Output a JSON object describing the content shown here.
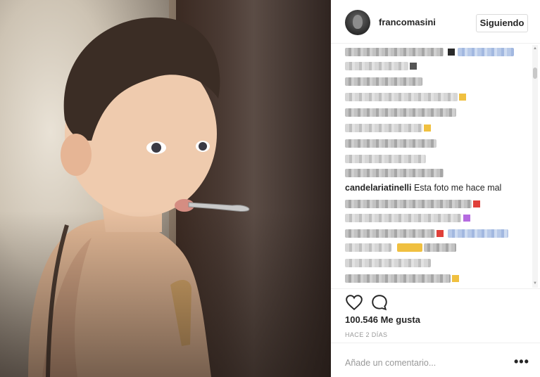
{
  "post": {
    "username": "francomasini",
    "follow_label": "Siguiendo",
    "likes": "100.546 Me gusta",
    "time_ago": "HACE 2 DÍAS",
    "add_comment_placeholder": "Añade un comentario...",
    "more_label": "•••"
  },
  "comments": {
    "visible_user": "candelariatinelli",
    "visible_text": "Esta foto me hace mal"
  },
  "icons": {
    "like": "heart-icon",
    "comment": "comment-icon",
    "more": "more-options-icon"
  },
  "colors": {
    "text": "#262626",
    "muted": "#999999",
    "border": "#dbdbdb"
  }
}
